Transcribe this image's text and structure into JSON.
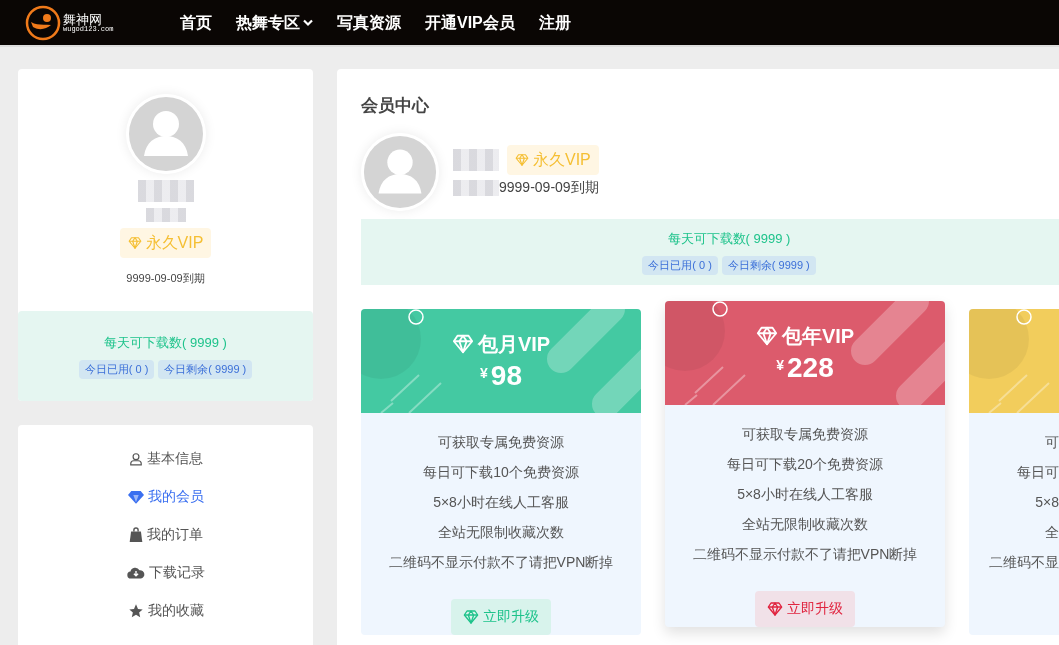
{
  "header": {
    "logo_title": "舞神网",
    "logo_domain": "wugod123.com",
    "nav": [
      {
        "label": "首页",
        "dropdown": false
      },
      {
        "label": "热舞专区",
        "dropdown": true
      },
      {
        "label": "写真资源",
        "dropdown": false
      },
      {
        "label": "开通VIP会员",
        "dropdown": false
      },
      {
        "label": "注册",
        "dropdown": false
      }
    ]
  },
  "profile_card": {
    "badge": "永久VIP",
    "expiry": "9999-09-09到期",
    "quota": {
      "title": "每天可下载数( 9999 )",
      "used": "今日已用( 0 )",
      "remaining": "今日剩余( 9999 )"
    }
  },
  "side_menu": [
    {
      "label": "基本信息",
      "selected": false
    },
    {
      "label": "我的会员",
      "selected": true
    },
    {
      "label": "我的订单",
      "selected": false
    },
    {
      "label": "下载记录",
      "selected": false
    },
    {
      "label": "我的收藏",
      "selected": false
    }
  ],
  "member_center": {
    "title": "会员中心",
    "badge": "永久VIP",
    "expiry": "9999-09-09到期",
    "quota": {
      "title": "每天可下载数( 9999 )",
      "used": "今日已用( 0 )",
      "remaining": "今日剩余( 9999 )"
    }
  },
  "plans": [
    {
      "title": "包月VIP",
      "currency": "¥",
      "price": "98",
      "color": "#44c9a2",
      "hovered": false,
      "features": [
        "可获取专属免费资源",
        "每日可下载10个免费资源",
        "5×8小时在线人工客服",
        "全站无限制收藏次数",
        "二维码不显示付款不了请把VPN断掉"
      ],
      "button": "立即升级"
    },
    {
      "title": "包年VIP",
      "currency": "¥",
      "price": "228",
      "color": "#dc5b6c",
      "hovered": true,
      "features": [
        "可获取专属免费资源",
        "每日可下载20个免费资源",
        "5×8小时在线人工客服",
        "全站无限制收藏次数",
        "二维码不显示付款不了请把VPN断掉"
      ],
      "button": "立即升级"
    },
    {
      "color": "#f2cd5c",
      "hovered": false,
      "features": [
        "可",
        "每日可",
        "5×8",
        "全",
        "二维码不显"
      ]
    }
  ]
}
